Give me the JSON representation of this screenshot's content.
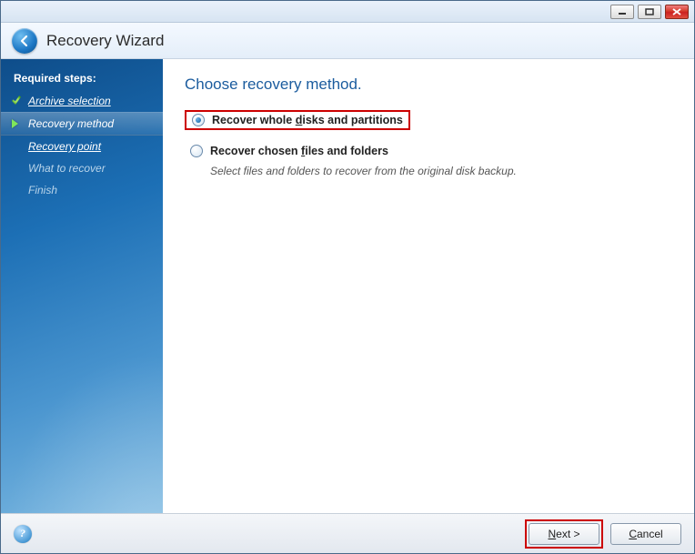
{
  "window": {
    "title": "Recovery Wizard"
  },
  "sidebar": {
    "heading": "Required steps:",
    "steps": [
      {
        "label": "Archive selection"
      },
      {
        "label": "Recovery method"
      },
      {
        "label": "Recovery point"
      },
      {
        "label": "What to recover"
      },
      {
        "label": "Finish"
      }
    ]
  },
  "main": {
    "heading": "Choose recovery method.",
    "options": [
      {
        "label_pre": "Recover whole ",
        "label_u": "d",
        "label_post": "isks and partitions",
        "selected": true,
        "desc": ""
      },
      {
        "label_pre": "Recover chosen ",
        "label_u": "f",
        "label_post": "iles and folders",
        "selected": false,
        "desc": "Select files and folders to recover from the original disk backup."
      }
    ]
  },
  "footer": {
    "next_u": "N",
    "next_post": "ext >",
    "cancel_u": "C",
    "cancel_post": "ancel"
  }
}
